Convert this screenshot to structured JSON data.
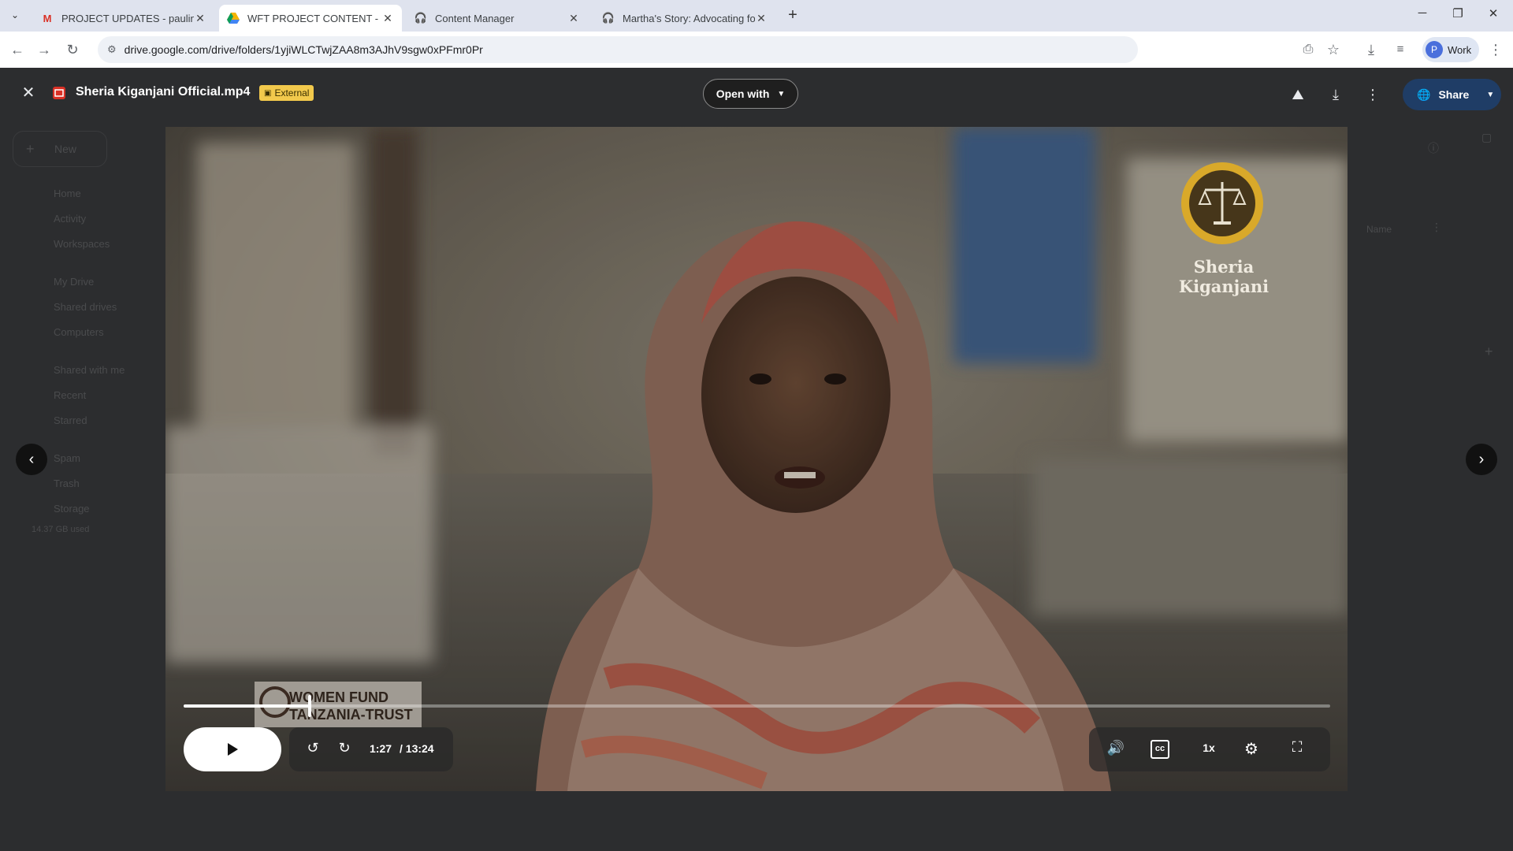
{
  "browser": {
    "tabs": [
      {
        "title": "PROJECT UPDATES - paulinate",
        "icon": "gmail-icon",
        "active": false
      },
      {
        "title": "WFT PROJECT CONTENT - Goo",
        "icon": "drive-icon",
        "active": true
      },
      {
        "title": "Content Manager",
        "icon": "notion-icon",
        "active": false
      },
      {
        "title": "Martha's Story: Advocating for",
        "icon": "notion-icon",
        "active": false
      }
    ],
    "url": "drive.google.com/drive/folders/1yjiWLCTwjZAA8m3AJhV9sgw0xPFmr0Pr",
    "profile_initial": "P",
    "profile_label": "Work"
  },
  "drive_bg": {
    "new_label": "New",
    "nav": [
      "Home",
      "Activity",
      "Workspaces",
      "My Drive",
      "Shared drives",
      "Computers",
      "Shared with me",
      "Recent",
      "Starred",
      "Spam",
      "Trash",
      "Storage"
    ],
    "storage_used": "14.37 GB used",
    "sort_label": "Name"
  },
  "viewer": {
    "file_name": "Sheria Kiganjani Official.mp4",
    "badge": "External",
    "open_with": "Open with",
    "share": "Share"
  },
  "video": {
    "brand_name": "Sheria Kiganjani",
    "lower_logo_line1": "WOMEN FUND",
    "lower_logo_line2": "TANZANIA-TRUST",
    "current_time": "1:27",
    "duration": "/ 13:24",
    "progress": 0.11,
    "speed": "1x"
  },
  "colors": {
    "share_bg": "#1f3d66",
    "badge_bg": "#f2c94c",
    "logo_gold": "#d9a92a"
  }
}
